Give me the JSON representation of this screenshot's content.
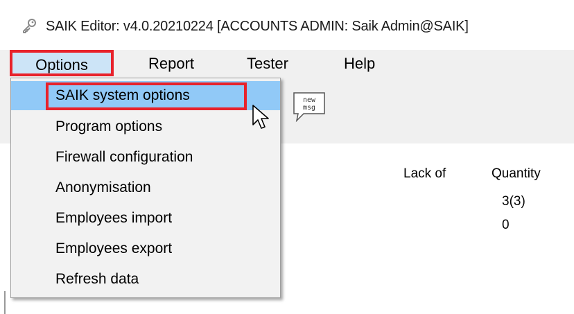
{
  "window": {
    "title": "SAIK Editor: v4.0.20210224 [ACCOUNTS ADMIN: Saik Admin@SAIK]",
    "icon": "key-icon"
  },
  "menubar": {
    "items": [
      {
        "label": "Options",
        "active": true
      },
      {
        "label": "Report"
      },
      {
        "label": "Tester"
      },
      {
        "label": "Help"
      }
    ]
  },
  "toolbar": {
    "newmsg_icon_text": [
      "new",
      "msg"
    ]
  },
  "dropdown": {
    "items": [
      {
        "label": "SAIK system options",
        "highlighted": true
      },
      {
        "label": "Program options"
      },
      {
        "label": "Firewall configuration"
      },
      {
        "label": "Anonymisation"
      },
      {
        "label": "Employees import"
      },
      {
        "label": "Employees export"
      },
      {
        "label": "Refresh data"
      }
    ]
  },
  "table": {
    "headers": [
      "Lack of",
      "Quantity"
    ],
    "quantity_values": [
      "3(3)",
      "0"
    ]
  },
  "colors": {
    "highlight_outline": "#e8222b",
    "menu_hover": "#cce4f7",
    "item_hover": "#91c9f7"
  }
}
